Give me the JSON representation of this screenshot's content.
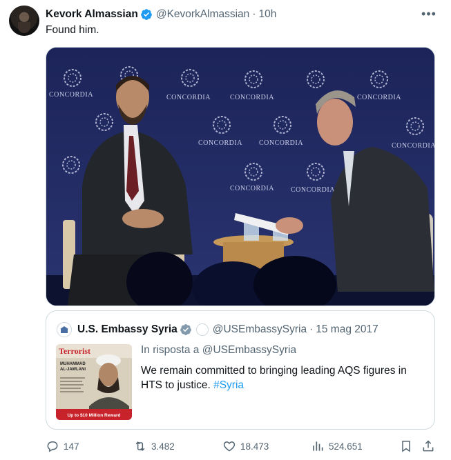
{
  "author": {
    "name": "Kevork Almassian",
    "handle": "@KevorkAlmassian",
    "time": "10h"
  },
  "tweet_text": "Found him.",
  "media": {
    "backdrop_text": "CONCORDIA"
  },
  "quoted": {
    "name": "U.S. Embassy Syria",
    "handle": "@USEmbassySyria",
    "date": "15 mag 2017",
    "reply_prefix": "In risposta a",
    "reply_to": "@USEmbassySyria",
    "text_main": "We remain committed to bringing leading AQS figures in HTS to justice.",
    "hashtag": "#Syria",
    "poster": {
      "title": "Terrorist",
      "first_name": "MUHAMMAD",
      "last_name": "AL-JAWLANI",
      "reward": "Up to $10 Million Reward"
    }
  },
  "actions": {
    "replies": "147",
    "reposts": "3.482",
    "likes": "18.473",
    "views": "524.651"
  },
  "colors": {
    "accent": "#1d9bf0",
    "secondary_text": "#536471",
    "poster_red": "#c8232a"
  },
  "icons": [
    "verified-badge-icon",
    "more-icon",
    "reply-icon",
    "repost-icon",
    "like-icon",
    "views-icon",
    "bookmark-icon",
    "share-icon"
  ]
}
